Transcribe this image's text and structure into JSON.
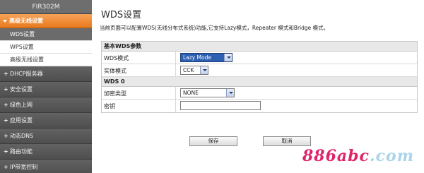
{
  "sidebar": {
    "brand": "FIR302M",
    "active_section": "高级无线设置",
    "subitems": [
      {
        "label": "WDS设置"
      },
      {
        "label": "WPS设置"
      },
      {
        "label": "高级无线设置"
      }
    ],
    "menu": [
      {
        "label": "DHCP服务器"
      },
      {
        "label": "安全设置"
      },
      {
        "label": "绿色上网"
      },
      {
        "label": "应用设置"
      },
      {
        "label": "动态DNS"
      },
      {
        "label": "路由功能"
      },
      {
        "label": "IP带宽控制"
      }
    ]
  },
  "main": {
    "title": "WDS设置",
    "description": "当前页面可以配置WDS(无线分布式系统)功能,它支持Lazy模式，Repeater 模式和Bridge 模式。",
    "basic_section": {
      "heading": "基本WDS参数",
      "wds_mode_label": "WDS模式",
      "wds_mode_value": "Lazy Mode",
      "phy_mode_label": "实体模式",
      "phy_mode_value": "CCK"
    },
    "wds0_section": {
      "heading": "WDS 0",
      "encryption_label": "加密类型",
      "encryption_value": "NONE",
      "key_label": "密钥",
      "key_value": ""
    },
    "save_label": "保存",
    "cancel_label": "取消"
  },
  "watermark": {
    "text_main": "886abc",
    "text_faded": ".com"
  },
  "colors": {
    "accent_orange": "#e9791c",
    "sidebar_gray": "#5a5a5a",
    "select_highlight": "#2d5fb3",
    "watermark_pink": "#e0246a"
  }
}
